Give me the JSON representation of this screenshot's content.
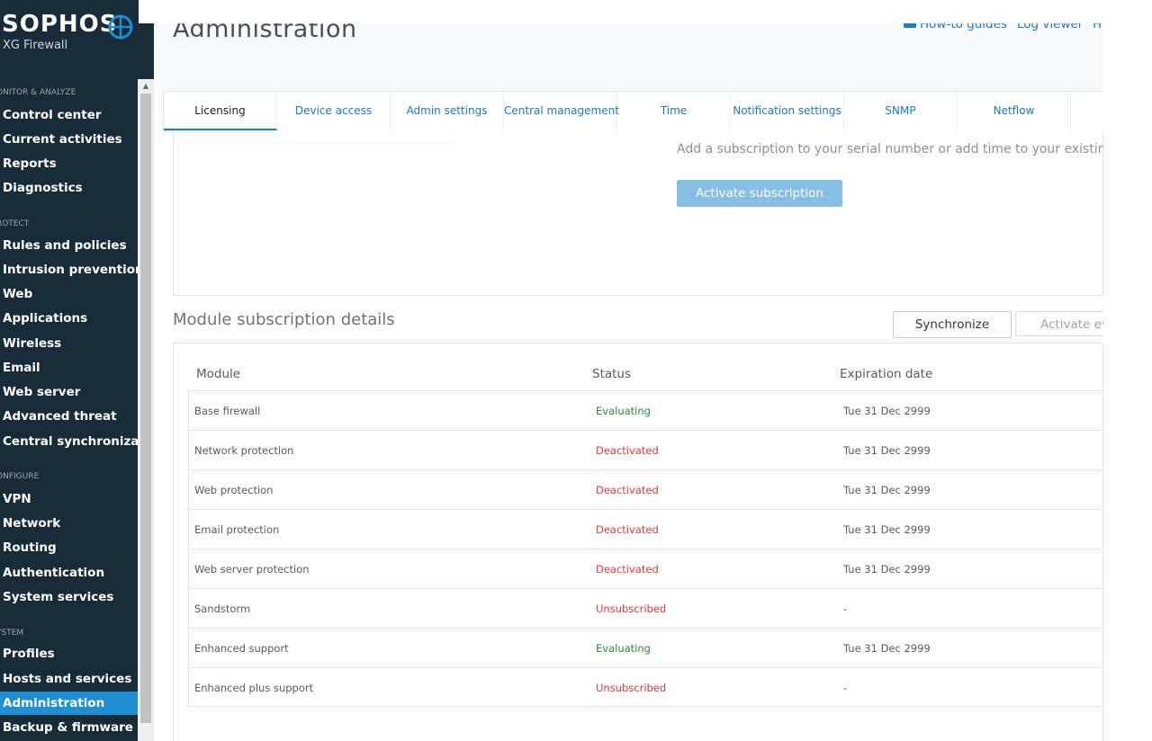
{
  "brand": {
    "logo": "SOPHOS",
    "product": "XG Firewall"
  },
  "sidebar": {
    "sections": [
      {
        "title": "ONITOR & ANALYZE",
        "items": [
          "Control center",
          "Current activities",
          "Reports",
          "Diagnostics"
        ]
      },
      {
        "title": "ROTECT",
        "items": [
          "Rules and policies",
          "Intrusion prevention",
          "Web",
          "Applications",
          "Wireless",
          "Email",
          "Web server",
          "Advanced threat",
          "Central synchronization"
        ]
      },
      {
        "title": "ONFIGURE",
        "items": [
          "VPN",
          "Network",
          "Routing",
          "Authentication",
          "System services"
        ]
      },
      {
        "title": "YSTEM",
        "items": [
          "Profiles",
          "Hosts and services",
          "Administration",
          "Backup & firmware"
        ]
      }
    ],
    "active_item": "Administration"
  },
  "header": {
    "title": "Administration",
    "links": [
      "How-to guides",
      "Log viewer",
      "H"
    ]
  },
  "tabs": [
    "Licensing",
    "Device access",
    "Admin settings",
    "Central management",
    "Time",
    "Notification settings",
    "SNMP",
    "Netflow"
  ],
  "active_tab": "Licensing",
  "subscription": {
    "text": "Add a subscription to your serial number or add time to your existing sub",
    "button": "Activate subscription"
  },
  "modules": {
    "heading": "Module subscription details",
    "sync_button": "Synchronize",
    "activate_eval_button": "Activate eva",
    "columns": [
      "Module",
      "Status",
      "Expiration date"
    ],
    "rows": [
      {
        "module": "Base firewall",
        "status": "Evaluating",
        "expiration": "Tue 31 Dec 2999"
      },
      {
        "module": "Network protection",
        "status": "Deactivated",
        "expiration": "Tue 31 Dec 2999"
      },
      {
        "module": "Web protection",
        "status": "Deactivated",
        "expiration": "Tue 31 Dec 2999"
      },
      {
        "module": "Email protection",
        "status": "Deactivated",
        "expiration": "Tue 31 Dec 2999"
      },
      {
        "module": "Web server protection",
        "status": "Deactivated",
        "expiration": "Tue 31 Dec 2999"
      },
      {
        "module": "Sandstorm",
        "status": "Unsubscribed",
        "expiration": "-"
      },
      {
        "module": "Enhanced support",
        "status": "Evaluating",
        "expiration": "Tue 31 Dec 2999"
      },
      {
        "module": "Enhanced plus support",
        "status": "Unsubscribed",
        "expiration": "-"
      }
    ]
  },
  "colors": {
    "sidebar_bg": "#182b39",
    "accent": "#1f8fd1",
    "link": "#1f7ac1",
    "evaluating": "#2e8b3a",
    "deactivated": "#e0393e"
  }
}
